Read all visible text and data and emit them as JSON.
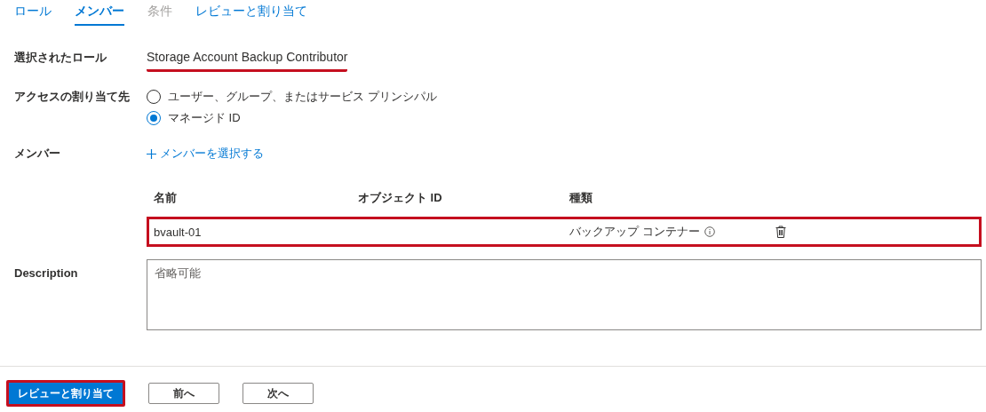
{
  "tabs": [
    {
      "label": "ロール",
      "selected": false,
      "disabled": false
    },
    {
      "label": "メンバー",
      "selected": true,
      "disabled": false
    },
    {
      "label": "条件",
      "selected": false,
      "disabled": true
    },
    {
      "label": "レビューと割り当て",
      "selected": false,
      "disabled": false
    }
  ],
  "selected_role": {
    "label": "選択されたロール",
    "value": "Storage Account Backup Contributor",
    "highlighted": true
  },
  "assign_access": {
    "label": "アクセスの割り当て先",
    "options": [
      {
        "label": "ユーザー、グループ、またはサービス プリンシパル",
        "selected": false
      },
      {
        "label": "マネージド ID",
        "selected": true
      }
    ]
  },
  "members": {
    "label": "メンバー",
    "add_link": "メンバーを選択する",
    "table": {
      "columns": [
        "名前",
        "オブジェクト ID",
        "種類"
      ],
      "rows": [
        {
          "name": "bvault-01",
          "object_id": "",
          "type": "バックアップ コンテナー",
          "highlighted": true
        }
      ]
    }
  },
  "description": {
    "label": "Description",
    "placeholder": "省略可能"
  },
  "buttons": [
    {
      "label": "レビューと割り当て",
      "kind": "primary",
      "highlighted": true
    },
    {
      "label": "前へ",
      "kind": "secondary",
      "highlighted": false
    },
    {
      "label": "次へ",
      "kind": "secondary",
      "highlighted": false
    }
  ]
}
